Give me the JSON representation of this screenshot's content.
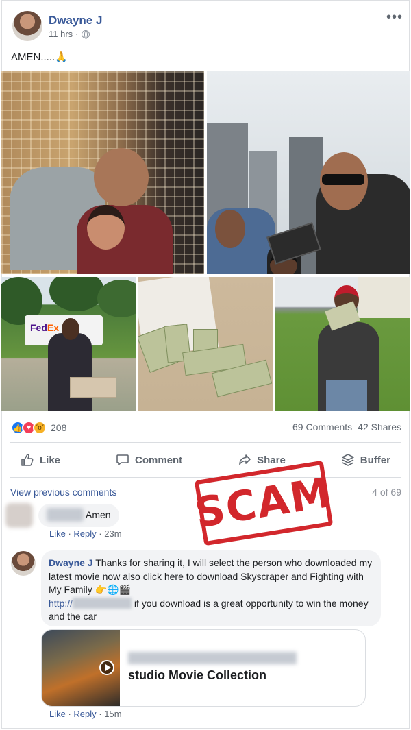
{
  "post": {
    "author": "Dwayne J",
    "time": "11 hrs",
    "separator": "·",
    "more": "•••",
    "text": "AMEN.....🙏"
  },
  "photos": {
    "fedex_logo_a": "Fed",
    "fedex_logo_b": "Ex"
  },
  "reactions": {
    "count": "208",
    "comments": "69 Comments",
    "shares": "42 Shares"
  },
  "actions": {
    "like": "Like",
    "comment": "Comment",
    "share": "Share",
    "buffer": "Buffer"
  },
  "comments": {
    "view_previous": "View previous comments",
    "count_of": "4 of 69",
    "first": {
      "text": "Amen",
      "like": "Like",
      "reply": "Reply",
      "time": "23m"
    },
    "second": {
      "author": "Dwayne J",
      "text": "Thanks for sharing it, I will select the person who downloaded my latest movie now also click here to download Skyscraper and Fighting with My Family 👉🌐🎬",
      "url_prefix": "http://",
      "text_after_url": " if you download is a great opportunity to win the money and the car",
      "like": "Like",
      "reply": "Reply",
      "time": "15m"
    },
    "link_preview": {
      "title": "studio Movie Collection"
    }
  },
  "overlay": {
    "stamp": "SCAM"
  },
  "colors": {
    "link": "#385898",
    "stamp": "#d2272c",
    "like_reaction": "#1877f2",
    "love_reaction": "#f33e58",
    "wow_reaction": "#f7b125"
  }
}
